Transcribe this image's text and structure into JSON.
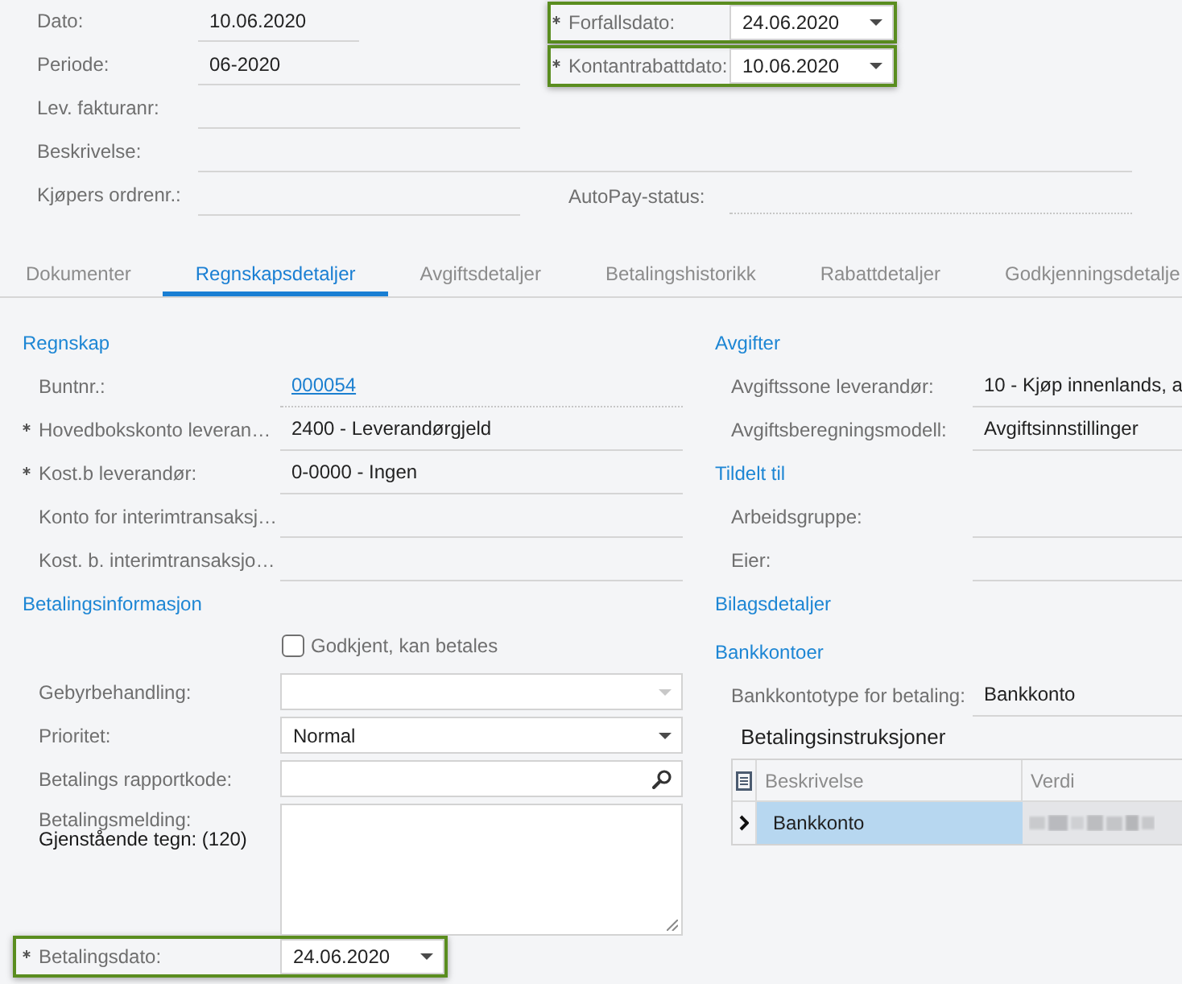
{
  "header": {
    "fields": [
      {
        "label": "Dato:",
        "value": "10.06.2020"
      },
      {
        "label": "Periode:",
        "value": "06-2020"
      },
      {
        "label": "Lev. fakturanr:"
      },
      {
        "label": "Beskrivelse:"
      },
      {
        "label": "Kjøpers ordrenr.:"
      }
    ],
    "side_fields": [
      {
        "kind": "date",
        "label": "Forfallsdato:",
        "value": "24.06.2020",
        "required": true,
        "highlighted": true
      },
      {
        "kind": "date",
        "label": "Kontantrabattdato:",
        "value": "10.06.2020",
        "required": true,
        "highlighted": true
      },
      {
        "kind": "readonly",
        "label": "AutoPay-status:",
        "required": false,
        "highlighted": false
      }
    ]
  },
  "tabs": [
    {
      "label": "Dokumenter",
      "selected": false
    },
    {
      "label": "Regnskapsdetaljer",
      "selected": true
    },
    {
      "label": "Avgiftsdetaljer",
      "selected": false
    },
    {
      "label": "Betalingshistorikk",
      "selected": false
    },
    {
      "label": "Rabattdetaljer",
      "selected": false
    },
    {
      "label": "Godkjenningsdetalje",
      "selected": false
    }
  ],
  "left_column": [
    {
      "title": "Regnskap",
      "fields": [
        {
          "kind": "link",
          "label": "Buntnr.:",
          "value": "000054",
          "required": false,
          "highlighted": false
        },
        {
          "kind": "text",
          "label": "Hovedbokskonto leveran…",
          "value": "2400 - Leverandørgjeld",
          "required": true,
          "highlighted": false
        },
        {
          "kind": "text",
          "label": "Kost.b leverandør:",
          "value": "0-0000 - Ingen",
          "required": true,
          "highlighted": false
        },
        {
          "kind": "text",
          "label": "Konto for interimtransaksj…",
          "required": false,
          "highlighted": false
        },
        {
          "kind": "text",
          "label": "Kost. b. interimtransaksjo…",
          "required": false,
          "highlighted": false
        }
      ]
    },
    {
      "title": "Betalingsinformasjon",
      "fields": [
        {
          "kind": "checkbox",
          "label": "Godkjent, kan betales",
          "checked": false,
          "required": false,
          "highlighted": false
        },
        {
          "kind": "select",
          "label": "Gebyrbehandling:",
          "disabled": true,
          "required": false,
          "highlighted": false
        },
        {
          "kind": "select",
          "label": "Prioritet:",
          "value": "Normal",
          "disabled": false,
          "required": false,
          "highlighted": false
        },
        {
          "kind": "lookup",
          "label": "Betalings rapportkode:",
          "required": false,
          "highlighted": false
        },
        {
          "kind": "textarea",
          "label": "Betalingsmelding:",
          "counter": "Gjenstående tegn: (120)",
          "required": false,
          "highlighted": false
        },
        {
          "kind": "date",
          "label": "Betalingsdato:",
          "value": "24.06.2020",
          "required": true,
          "highlighted": true
        }
      ]
    }
  ],
  "right_column": [
    {
      "title": "Avgifter",
      "fields": [
        {
          "kind": "text",
          "label": "Avgiftssone leverandør:",
          "value": "10 - Kjøp innenlands, a",
          "required": false,
          "highlighted": false
        },
        {
          "kind": "text",
          "label": "Avgiftsberegningsmodell:",
          "value": "Avgiftsinnstillinger",
          "required": false,
          "highlighted": false
        }
      ]
    },
    {
      "title": "Tildelt til",
      "fields": [
        {
          "kind": "text",
          "label": "Arbeidsgruppe:",
          "required": false,
          "highlighted": false
        },
        {
          "kind": "text",
          "label": "Eier:",
          "required": false,
          "highlighted": false
        }
      ]
    },
    {
      "title": "Bilagsdetaljer"
    },
    {
      "title": "Bankkontoer",
      "fields": [
        {
          "kind": "text",
          "label": "Bankkontotype for betaling:",
          "value": "Bankkonto",
          "required": false,
          "highlighted": false
        }
      ],
      "grid": {
        "title": "Betalingsinstruksjoner",
        "columns": [
          "Beskrivelse",
          "Verdi"
        ],
        "rows": [
          {
            "selected": true,
            "cells": [
              {
                "text": "Bankkonto",
                "redacted": false
              },
              {
                "redacted": true
              }
            ]
          }
        ]
      }
    }
  ]
}
